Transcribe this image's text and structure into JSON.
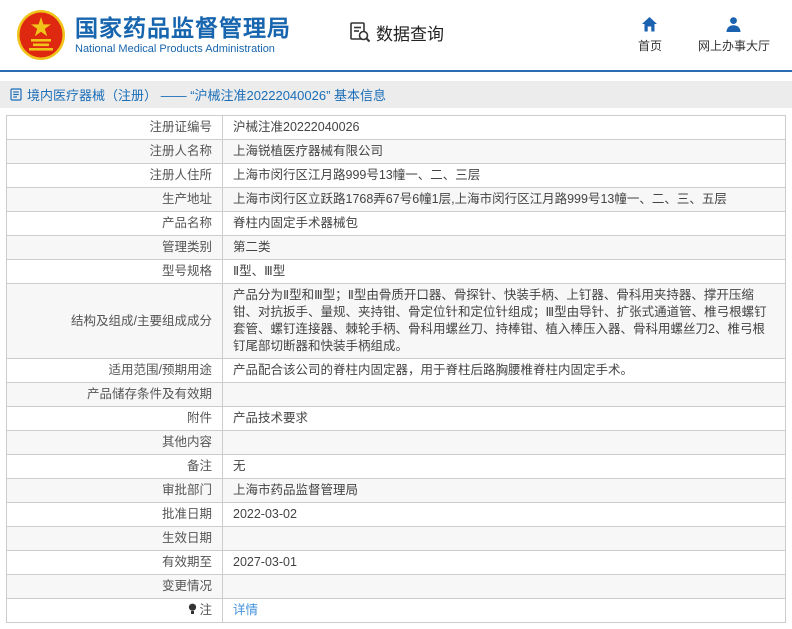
{
  "header": {
    "site_name_cn": "国家药品监督管理局",
    "site_name_en": "National Medical Products Administration",
    "nav_data_query": "数据查询",
    "nav_home": "首页",
    "nav_service_hall": "网上办事大厅"
  },
  "title_bar": {
    "text": "境内医疗器械（注册） —— “沪械注准20222040026” 基本信息"
  },
  "table": {
    "rows": [
      {
        "label": "注册证编号",
        "value": "沪械注准20222040026"
      },
      {
        "label": "注册人名称",
        "value": "上海锐植医疗器械有限公司"
      },
      {
        "label": "注册人住所",
        "value": "上海市闵行区江月路999号13幢一、二、三层"
      },
      {
        "label": "生产地址",
        "value": "上海市闵行区立跃路1768弄67号6幢1层,上海市闵行区江月路999号13幢一、二、三、五层"
      },
      {
        "label": "产品名称",
        "value": "脊柱内固定手术器械包"
      },
      {
        "label": "管理类别",
        "value": "第二类"
      },
      {
        "label": "型号规格",
        "value": "Ⅱ型、Ⅲ型"
      },
      {
        "label": "结构及组成/主要组成成分",
        "value": "产品分为Ⅱ型和Ⅲ型；Ⅱ型由骨质开口器、骨探针、快装手柄、上钉器、骨科用夹持器、撑开压缩钳、对抗扳手、量规、夹持钳、骨定位针和定位针组成；Ⅲ型由导针、扩张式通道管、椎弓根螺钉套管、螺钉连接器、棘轮手柄、骨科用螺丝刀、持棒钳、植入棒压入器、骨科用螺丝刀2、椎弓根钉尾部切断器和快装手柄组成。"
      },
      {
        "label": "适用范围/预期用途",
        "value": "产品配合该公司的脊柱内固定器，用于脊柱后路胸腰椎脊柱内固定手术。"
      },
      {
        "label": "产品储存条件及有效期",
        "value": ""
      },
      {
        "label": "附件",
        "value": "产品技术要求"
      },
      {
        "label": "其他内容",
        "value": ""
      },
      {
        "label": "备注",
        "value": "无"
      },
      {
        "label": "审批部门",
        "value": "上海市药品监督管理局"
      },
      {
        "label": "批准日期",
        "value": "2022-03-02"
      },
      {
        "label": "生效日期",
        "value": ""
      },
      {
        "label": "有效期至",
        "value": "2027-03-01"
      },
      {
        "label": "变更情况",
        "value": ""
      },
      {
        "label": "注",
        "value": "详情"
      }
    ]
  },
  "colors": {
    "brand_blue": "#1765ae",
    "rule_blue": "#2a6db3",
    "titlebar_bg": "#ececec",
    "titlebar_text": "#1a6eb8",
    "table_border": "#cccccc",
    "stripe_bg": "#f7f7f7",
    "link_blue": "#4192dd",
    "emblem_red": "#de2910",
    "emblem_gold": "#f0c419"
  }
}
